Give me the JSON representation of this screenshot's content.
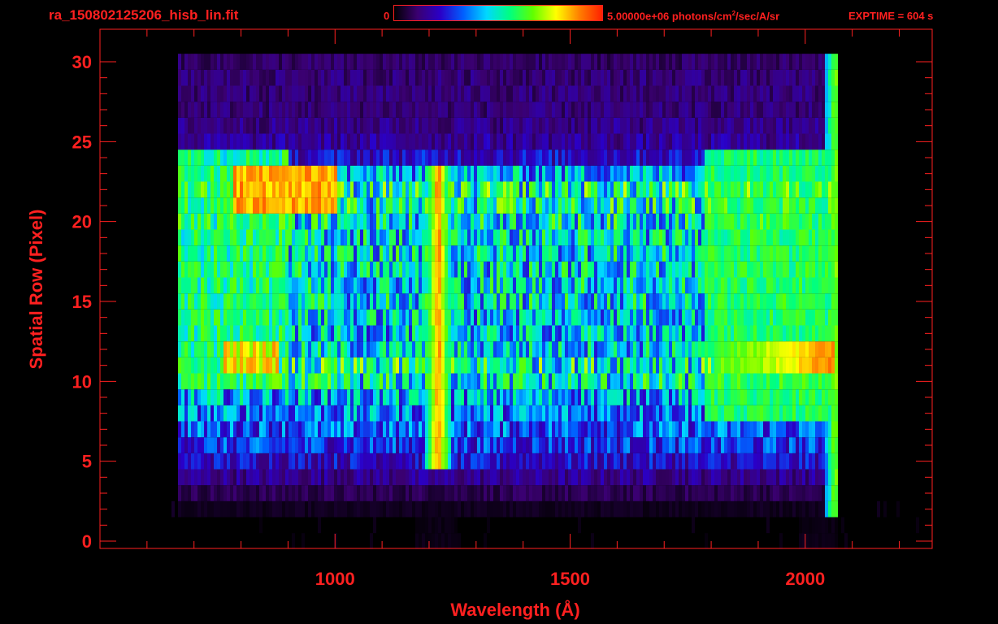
{
  "header": {
    "filename": "ra_150802125206_hisb_lin.fit",
    "colorbar_min_label": "0",
    "colorbar_max_label_pre": "5.00000e+06 photons/cm",
    "colorbar_max_label_sup": "2",
    "colorbar_max_label_post": "/sec/A/sr",
    "exptime_label": "EXPTIME = 604 s"
  },
  "colors": {
    "axis": "#ff2020",
    "background": "#000000",
    "colormap": [
      "#000000",
      "#3a0070",
      "#2a00c8",
      "#0060ff",
      "#00d8ff",
      "#00ff80",
      "#60ff00",
      "#ffff00",
      "#ff8000",
      "#ff2000"
    ]
  },
  "chart_data": {
    "type": "heatmap",
    "title": "",
    "xlabel": "Wavelength (Å)",
    "ylabel": "Spatial Row (Pixel)",
    "xlim": [
      500,
      2270
    ],
    "ylim": [
      0,
      30
    ],
    "x_ticks": [
      1000,
      1500,
      2000
    ],
    "y_ticks": [
      0,
      5,
      10,
      15,
      20,
      25,
      30
    ],
    "colorbar_range": [
      0,
      5000000
    ],
    "colorbar_units": "photons/cm^2/sec/A/sr",
    "rows": 31,
    "row_intensity_0_1": [
      0.02,
      0.02,
      0.03,
      0.08,
      0.15,
      0.22,
      0.28,
      0.32,
      0.36,
      0.4,
      0.48,
      0.52,
      0.44,
      0.42,
      0.44,
      0.46,
      0.46,
      0.46,
      0.46,
      0.46,
      0.48,
      0.5,
      0.52,
      0.4,
      0.22,
      0.16,
      0.14,
      0.12,
      0.12,
      0.12,
      0.1
    ],
    "features": [
      {
        "label": "Lyman-alpha line",
        "wavelength": 1216,
        "rows": [
          5,
          23
        ],
        "peak": 0.95
      },
      {
        "label": "bright band",
        "wavelength_range": [
          1800,
          2060
        ],
        "rows": [
          11,
          12
        ],
        "peak": 0.85
      },
      {
        "label": "detector edge",
        "wavelength": 2060,
        "rows": [
          2,
          30
        ],
        "peak": 0.75
      }
    ]
  }
}
